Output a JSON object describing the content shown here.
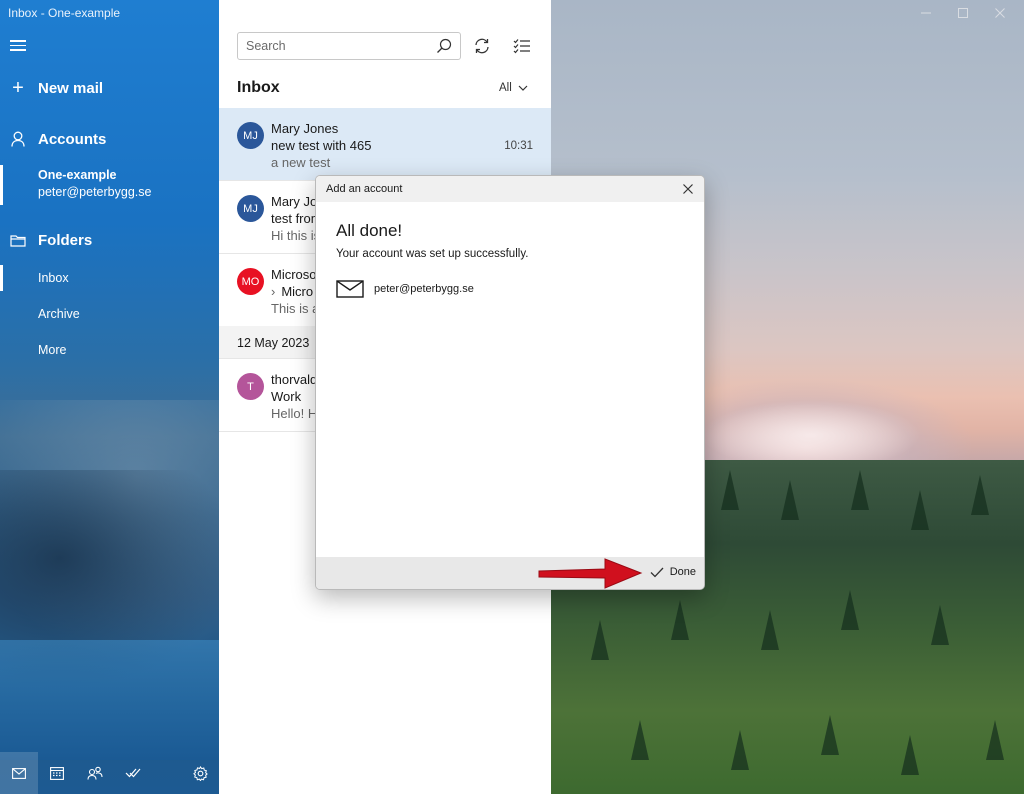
{
  "window": {
    "title": "Inbox - One-example"
  },
  "sidebar": {
    "new_mail": "New mail",
    "accounts_header": "Accounts",
    "account": {
      "name": "One-example",
      "email": "peter@peterbygg.se"
    },
    "folders_header": "Folders",
    "folders": [
      {
        "label": "Inbox",
        "selected": true
      },
      {
        "label": "Archive",
        "selected": false
      },
      {
        "label": "More",
        "selected": false
      }
    ],
    "bottom_icons": [
      "mail-icon",
      "calendar-icon",
      "people-icon",
      "todo-icon",
      "settings-icon"
    ]
  },
  "message_list": {
    "search_placeholder": "Search",
    "title": "Inbox",
    "filter": "All",
    "messages": [
      {
        "initials": "MJ",
        "avatar_color": "#2b579a",
        "from": "Mary Jones",
        "subject": "new test with 465",
        "preview": "a new test",
        "time": "10:31",
        "selected": true
      },
      {
        "initials": "MJ",
        "avatar_color": "#2b579a",
        "from": "Mary Jones",
        "subject": "test from",
        "preview": "Hi this is",
        "time": ""
      },
      {
        "initials": "MO",
        "avatar_color": "#e81123",
        "from": "Microsoft",
        "subject": "Micro",
        "preview": "This is a",
        "time": ""
      }
    ],
    "date_header": "12 May 2023",
    "messages_older": [
      {
        "initials": "T",
        "avatar_color": "#b4559a",
        "from": "thorvald",
        "subject": "Work",
        "preview": "Hello! H",
        "time": ""
      }
    ]
  },
  "dialog": {
    "title": "Add an account",
    "heading": "All done!",
    "message": "Your account was set up successfully.",
    "account_email": "peter@peterbygg.se",
    "done_label": "Done"
  },
  "colors": {
    "accent": "#0078d4",
    "annotation_arrow": "#d0101e"
  }
}
